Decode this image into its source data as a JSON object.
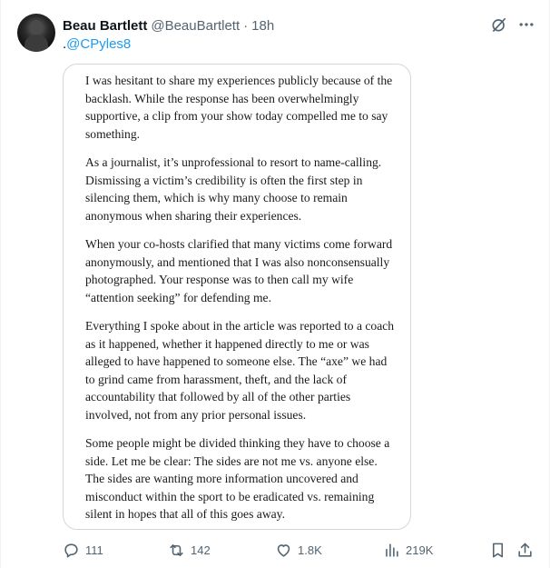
{
  "author": {
    "display_name": "Beau Bartlett",
    "handle": "@BeauBartlett",
    "time": "18h"
  },
  "reply": {
    "prefix": ".",
    "mention": "@CPyles8"
  },
  "letter": {
    "paragraphs": [
      "I was hesitant to share my experiences publicly because of the backlash. While the response has been overwhelmingly supportive, a clip from your show today compelled me to say something.",
      "As a journalist, it’s unprofessional to resort to name-calling. Dismissing a victim’s credibility is often the first step in silencing them, which is why many choose to remain anonymous when sharing their experiences.",
      "When your co-hosts clarified that many victims come forward anonymously, and mentioned that I was also nonconsensually photographed. Your response was to then call my wife “attention seeking” for defending me.",
      "Everything I spoke about in the article was reported to a coach as it happened, whether it happened directly to me or was alleged to have happened to someone else. The “axe” we had to grind came from harassment, theft, and the lack of accountability that followed by all of the other parties involved, not from any prior personal issues.",
      "Some people might be divided thinking they have to choose a side. Let me be clear: The sides are not me vs. anyone else. The sides are wanting more information uncovered and misconduct within the sport to be eradicated vs. remaining silent in hopes that all of this goes away."
    ]
  },
  "metrics": {
    "replies": "111",
    "reposts": "142",
    "likes": "1.8K",
    "views": "219K"
  },
  "icons": {
    "top": [
      "grok-icon",
      "more-icon"
    ],
    "actions": [
      "reply-icon",
      "repost-icon",
      "like-icon",
      "views-icon",
      "bookmark-icon",
      "share-icon"
    ]
  },
  "colors": {
    "link": "#1d9bf0",
    "muted": "#536471",
    "text": "#0f1419",
    "border": "#cfd9de"
  }
}
